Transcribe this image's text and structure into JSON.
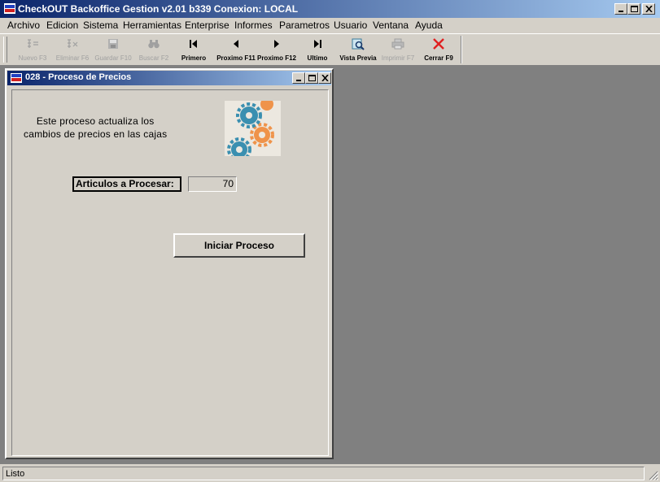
{
  "app": {
    "title": "CheckOUT Backoffice Gestion v2.01 b339 Conexion: LOCAL"
  },
  "menu": [
    "Archivo",
    "Edicion",
    "Sistema",
    "Herramientas",
    "Enterprise",
    "Informes",
    "Parametros",
    "Usuario",
    "Ventana",
    "Ayuda"
  ],
  "toolbar": {
    "nuevo": "Nuevo F3",
    "eliminar": "Eliminar F6",
    "guardar": "Guardar F10",
    "buscar": "Buscar F2",
    "primero": "Primero",
    "proximo11": "Proximo F11",
    "proximo12": "Proximo F12",
    "ultimo": "Ultimo",
    "vista": "Vista Previa",
    "imprimir": "Imprimir F7",
    "cerrar": "Cerrar F9"
  },
  "child": {
    "title": "028 - Proceso de Precios",
    "description_line1": "Este proceso actualiza los",
    "description_line2": "cambios de precios en las cajas",
    "label": "Articulos a Procesar:",
    "value": "70",
    "button": "Iniciar Proceso"
  },
  "status": {
    "text": "Listo"
  },
  "colors": {
    "titlebar_start": "#0a246a",
    "titlebar_end": "#a6caf0",
    "workspace": "#808080",
    "close_red": "#e02020",
    "gear_blue": "#3a8fb0",
    "gear_orange": "#f08a3a"
  }
}
